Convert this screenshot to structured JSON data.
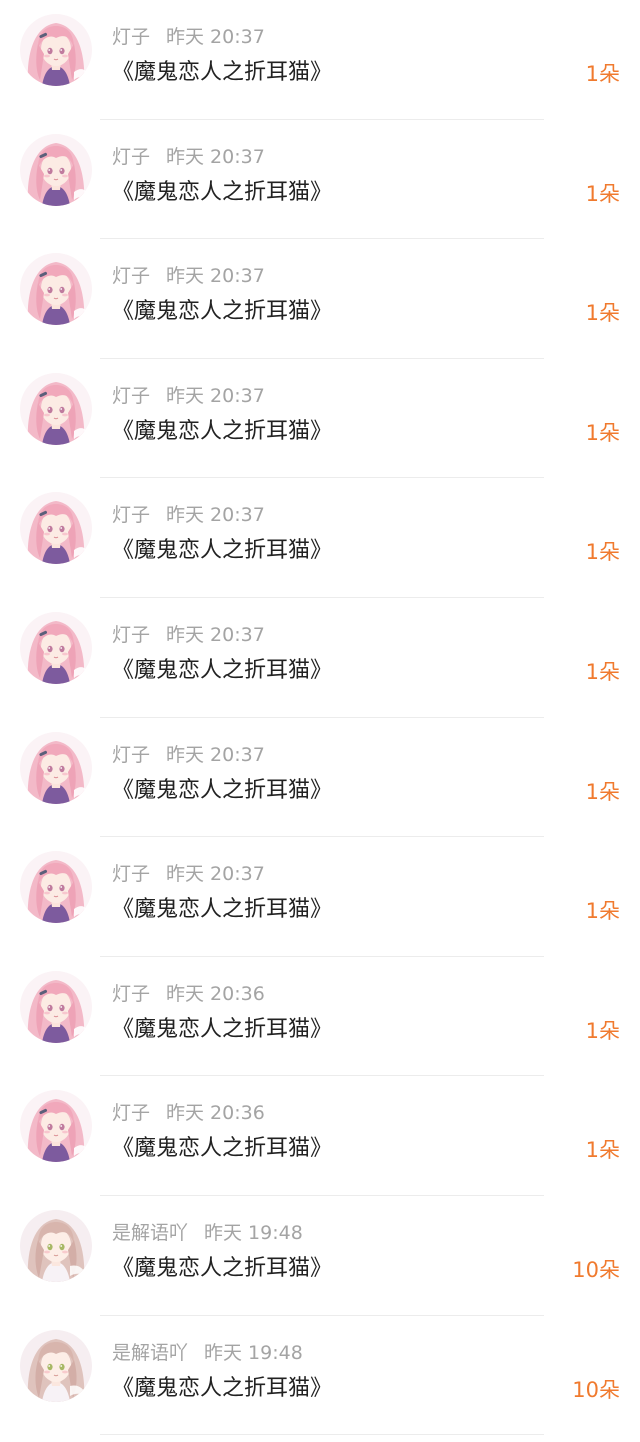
{
  "accent_color": "#f07a2e",
  "records": [
    {
      "user": "灯子",
      "time": "昨天 20:37",
      "title": "《魔鬼恋人之折耳猫》",
      "count": "1朵",
      "avatar": "pink-hair"
    },
    {
      "user": "灯子",
      "time": "昨天 20:37",
      "title": "《魔鬼恋人之折耳猫》",
      "count": "1朵",
      "avatar": "pink-hair"
    },
    {
      "user": "灯子",
      "time": "昨天 20:37",
      "title": "《魔鬼恋人之折耳猫》",
      "count": "1朵",
      "avatar": "pink-hair"
    },
    {
      "user": "灯子",
      "time": "昨天 20:37",
      "title": "《魔鬼恋人之折耳猫》",
      "count": "1朵",
      "avatar": "pink-hair"
    },
    {
      "user": "灯子",
      "time": "昨天 20:37",
      "title": "《魔鬼恋人之折耳猫》",
      "count": "1朵",
      "avatar": "pink-hair"
    },
    {
      "user": "灯子",
      "time": "昨天 20:37",
      "title": "《魔鬼恋人之折耳猫》",
      "count": "1朵",
      "avatar": "pink-hair"
    },
    {
      "user": "灯子",
      "time": "昨天 20:37",
      "title": "《魔鬼恋人之折耳猫》",
      "count": "1朵",
      "avatar": "pink-hair"
    },
    {
      "user": "灯子",
      "time": "昨天 20:37",
      "title": "《魔鬼恋人之折耳猫》",
      "count": "1朵",
      "avatar": "pink-hair"
    },
    {
      "user": "灯子",
      "time": "昨天 20:36",
      "title": "《魔鬼恋人之折耳猫》",
      "count": "1朵",
      "avatar": "pink-hair"
    },
    {
      "user": "灯子",
      "time": "昨天 20:36",
      "title": "《魔鬼恋人之折耳猫》",
      "count": "1朵",
      "avatar": "pink-hair"
    },
    {
      "user": "是解语吖",
      "time": "昨天 19:48",
      "title": "《魔鬼恋人之折耳猫》",
      "count": "10朵",
      "avatar": "beige-hair"
    },
    {
      "user": "是解语吖",
      "time": "昨天 19:48",
      "title": "《魔鬼恋人之折耳猫》",
      "count": "10朵",
      "avatar": "beige-hair"
    }
  ]
}
